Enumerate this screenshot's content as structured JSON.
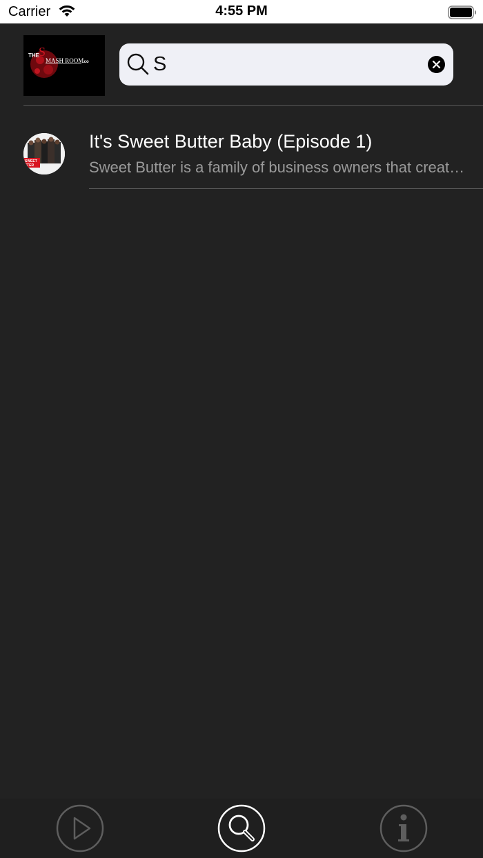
{
  "status_bar": {
    "carrier": "Carrier",
    "time": "4:55 PM"
  },
  "header": {
    "logo_text": "THE SMASH ROOM.co",
    "search": {
      "value": "S",
      "placeholder": ""
    }
  },
  "results": [
    {
      "title": "It's Sweet Butter Baby (Episode 1)",
      "description": "Sweet Butter is a family of business owners that create a..."
    }
  ],
  "tab_bar": {
    "tabs": [
      {
        "icon": "play-icon",
        "active": false
      },
      {
        "icon": "search-icon",
        "active": true
      },
      {
        "icon": "info-icon",
        "active": false
      }
    ]
  },
  "colors": {
    "background": "#222222",
    "search_field": "#eff0f6",
    "subtitle": "#9a9a9a",
    "active_tab": "#ffffff",
    "inactive_tab": "#5e5e5e",
    "logo_accent": "#b0101a"
  }
}
